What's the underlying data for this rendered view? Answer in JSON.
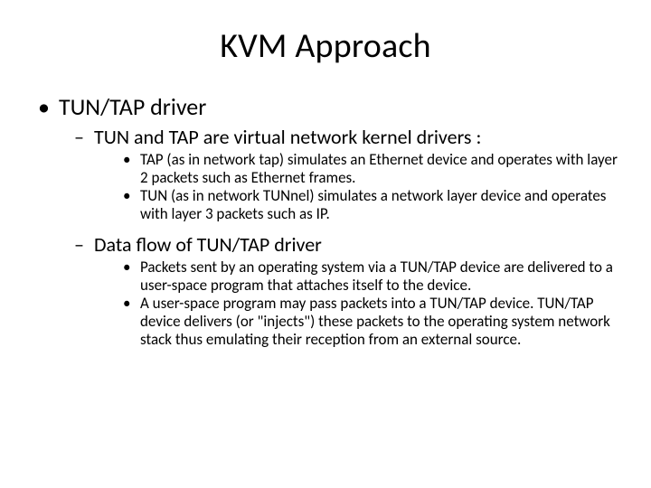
{
  "title": "KVM Approach",
  "bullets": {
    "lvl1_0": "TUN/TAP driver",
    "lvl2_0": "TUN and TAP are virtual network kernel drivers :",
    "lvl3_0": "TAP (as in network tap) simulates an Ethernet device and operates with layer 2 packets such as Ethernet frames.",
    "lvl3_1": "TUN (as in network TUNnel) simulates a network layer device and operates with layer 3 packets such as IP.",
    "lvl2_1": "Data flow of TUN/TAP driver",
    "lvl3_2": "Packets sent by an operating system via a TUN/TAP device are delivered to a user-space program that attaches itself to the device.",
    "lvl3_3": "A user-space program may pass packets into a TUN/TAP device. TUN/TAP device delivers (or \"injects\") these packets to the operating system network stack thus emulating their reception from an external source."
  },
  "glyphs": {
    "dot": "•",
    "dash": "–"
  }
}
